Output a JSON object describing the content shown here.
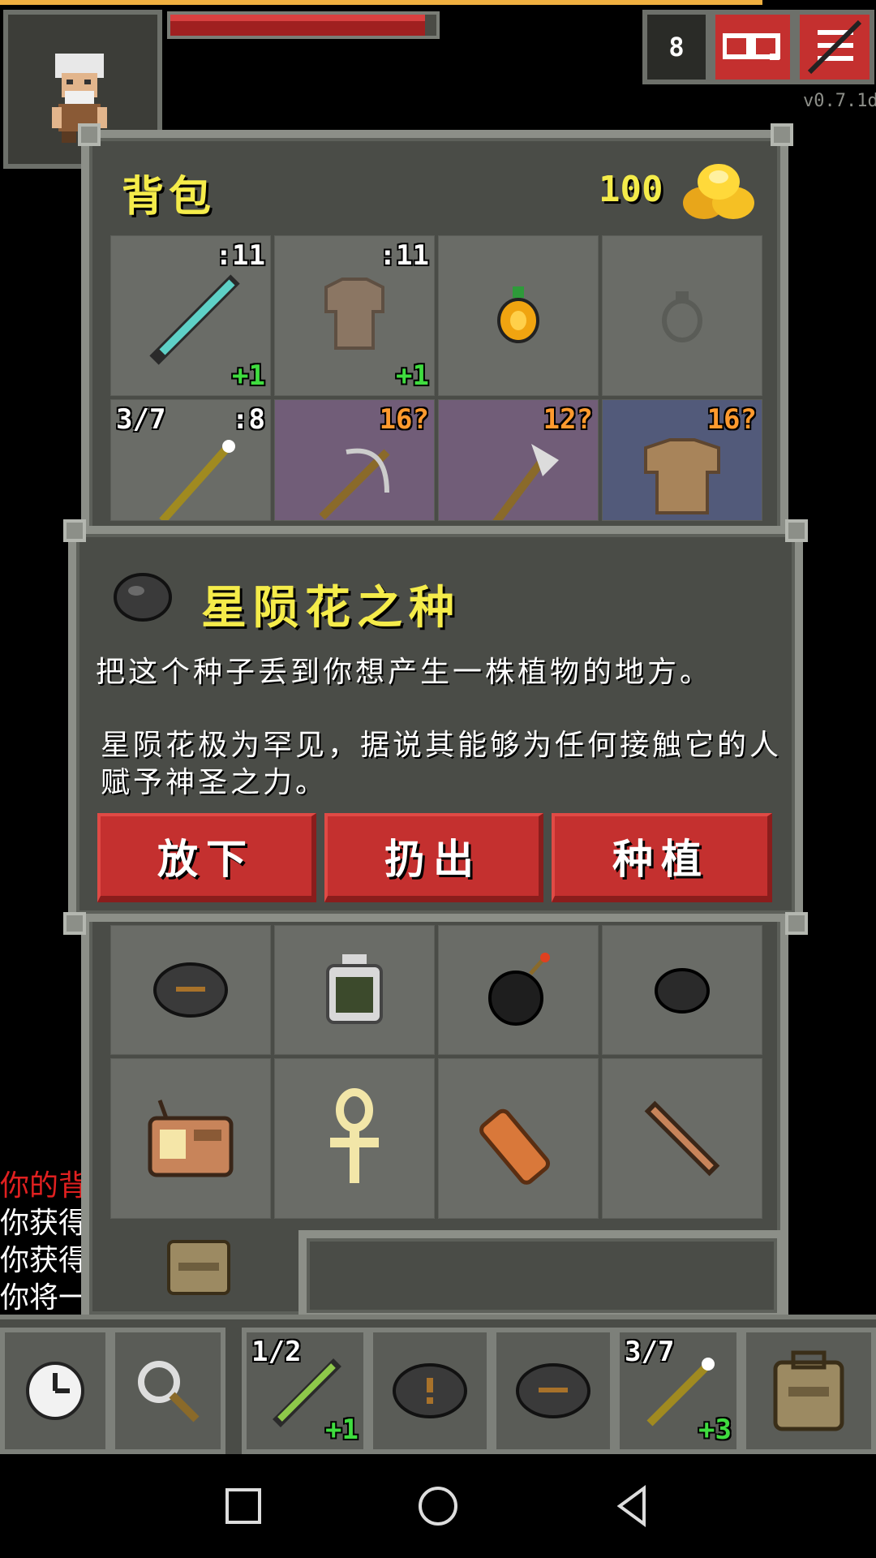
{
  "hud": {
    "depth": "8",
    "version": "v0.7.1d"
  },
  "backpack": {
    "title": "背包",
    "gold": "100",
    "slots": [
      {
        "icon": "sword-icon",
        "tr": ":11",
        "br": "+1",
        "bg": "normal"
      },
      {
        "icon": "leather-armor-icon",
        "tr": ":11",
        "br": "+1",
        "bg": "normal"
      },
      {
        "icon": "amulet-icon",
        "bg": "normal"
      },
      {
        "icon": "ring-slot-icon",
        "bg": "normal"
      },
      {
        "icon": "wand-icon",
        "tl": "3/7",
        "tr": ":8",
        "bg": "normal"
      },
      {
        "icon": "crossbow-icon",
        "tr": "16?",
        "bg": "purple"
      },
      {
        "icon": "axe-icon",
        "tr": "12?",
        "bg": "purple"
      },
      {
        "icon": "armor-icon",
        "tr": "16?",
        "bg": "blue"
      }
    ],
    "lower_slots": [
      {
        "icon": "seed-icon"
      },
      {
        "icon": "potion-icon"
      },
      {
        "icon": "bomb-icon"
      },
      {
        "icon": "stone-icon"
      },
      {
        "icon": "radio-icon"
      },
      {
        "icon": "ankh-icon"
      },
      {
        "icon": "scroll-icon"
      },
      {
        "icon": "dagger-icon"
      }
    ]
  },
  "item": {
    "icon": "seed-icon",
    "title": "星陨花之种",
    "desc1": "把这个种子丢到你想产生一株植物的地方。",
    "desc2": "星陨花极为罕见，据说其能够为任何接触它的人赋予神圣之力。",
    "actions": {
      "drop": "放下",
      "throw": "扔出",
      "plant": "种植"
    }
  },
  "log": [
    "你的背",
    "你获得",
    "你获得",
    "你将一"
  ],
  "toolbar": {
    "wait_icon": "clock-icon",
    "search_icon": "magnifier-icon",
    "quickslots": [
      {
        "icon": "wand-icon",
        "tl": "1/2",
        "br": "+1"
      },
      {
        "icon": "seed-icon"
      },
      {
        "icon": "seed-icon"
      },
      {
        "icon": "wand-icon",
        "tl": "3/7",
        "br": "+3"
      }
    ],
    "inventory_icon": "backpack-icon"
  },
  "colors": {
    "accent_red": "#c4302f",
    "title_yellow": "#f5ec4a",
    "frame": "#8c8f88",
    "panel": "#4a4c47"
  }
}
